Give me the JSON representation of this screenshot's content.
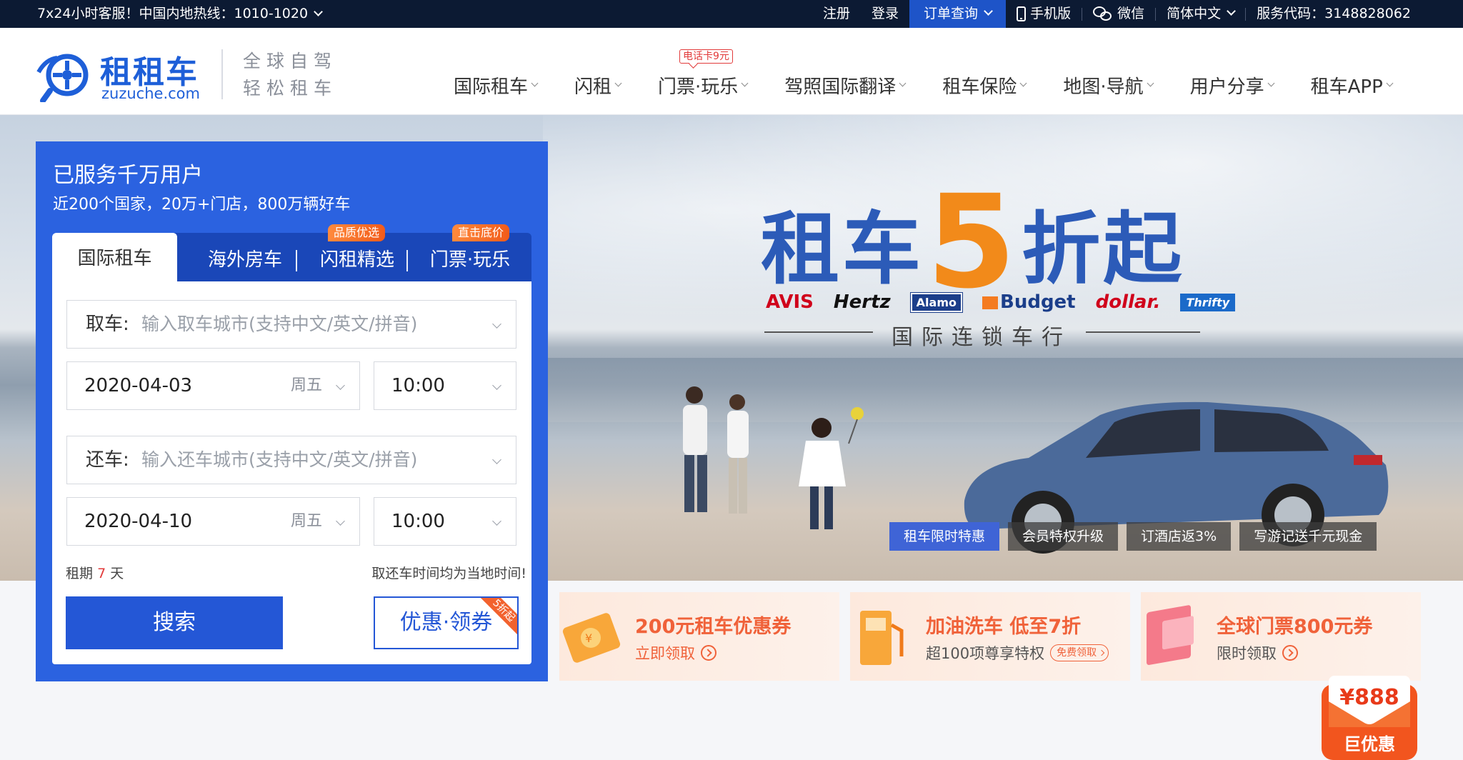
{
  "topbar": {
    "hotline": "7x24小时客服！中国内地热线：1010-1020",
    "register": "注册",
    "login": "登录",
    "order_query": "订单查询",
    "mobile": "手机版",
    "wechat": "微信",
    "language": "简体中文",
    "service_code": "服务代码：3148828062"
  },
  "header": {
    "logo_cn": "租租车",
    "logo_en": "zuzuche.com",
    "slogan_line1": "全球自驾",
    "slogan_line2": "轻松租车",
    "nav": [
      {
        "label": "国际租车"
      },
      {
        "label": "闪租"
      },
      {
        "label": "门票·玩乐",
        "badge": "电话卡9元"
      },
      {
        "label": "驾照国际翻译"
      },
      {
        "label": "租车保险"
      },
      {
        "label": "地图·导航"
      },
      {
        "label": "用户分享"
      },
      {
        "label": "租车APP"
      }
    ]
  },
  "banner": {
    "title_a": "租车",
    "title_num": "5",
    "title_b": "折起",
    "brands": [
      "AVIS",
      "Hertz",
      "Alamo",
      "Budget",
      "dollar.",
      "Thrifty"
    ],
    "chain_text": "国际连锁车行",
    "promo_tabs": [
      {
        "label": "租车限时特惠",
        "active": true
      },
      {
        "label": "会员特权升级",
        "active": false
      },
      {
        "label": "订酒店返3%",
        "active": false
      },
      {
        "label": "写游记送千元现金",
        "active": false
      }
    ]
  },
  "search": {
    "title": "已服务千万用户",
    "subtitle": "近200个国家，20万+门店，800万辆好车",
    "tabs": [
      {
        "label": "国际租车",
        "active": true
      },
      {
        "label": "海外房车"
      },
      {
        "label": "闪租精选",
        "badge": "品质优选"
      },
      {
        "label": "门票·玩乐",
        "badge": "直击底价"
      }
    ],
    "pickup_label": "取车:",
    "pickup_placeholder": "输入取车城市(支持中文/英文/拼音)",
    "pickup_date": "2020-04-03",
    "pickup_weekday": "周五",
    "pickup_time": "10:00",
    "return_label": "还车:",
    "return_placeholder": "输入还车城市(支持中文/英文/拼音)",
    "return_date": "2020-04-10",
    "return_weekday": "周五",
    "return_time": "10:00",
    "period_prefix": "租期",
    "period_days": "7",
    "period_suffix": "天",
    "local_time_note": "取还车时间均为当地时间!",
    "search_button": "搜索",
    "coupon_button": "优惠·领券",
    "coupon_corner": "5折起"
  },
  "coupons": [
    {
      "title": "200元租车优惠券",
      "sub": "立即领取"
    },
    {
      "title": "加油洗车 低至7折",
      "sub": "超100项尊享特权",
      "pill": "免费领取"
    },
    {
      "title": "全球门票800元券",
      "sub": "限时领取"
    }
  ],
  "float_badge": {
    "amount": "¥888",
    "label": "巨优惠"
  },
  "colors": {
    "brand_blue": "#2b62e0",
    "topbar_bg": "#0c1a33",
    "accent_orange": "#f28a1a",
    "coupon_red": "#f0623a"
  }
}
